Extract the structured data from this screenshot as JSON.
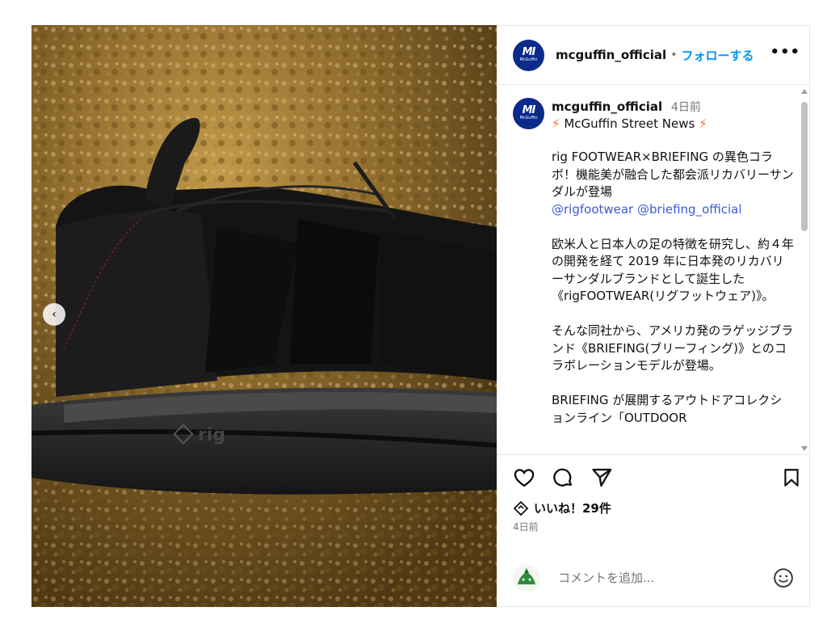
{
  "post": {
    "username": "mcguffin_official",
    "separator": "•",
    "follow_label": "フォローする",
    "more_label": "•••",
    "logo_mark": "MI",
    "logo_brand": "McGuffin"
  },
  "caption": {
    "username": "mcguffin_official",
    "time_ago": "4日前",
    "subtitle_icon": "⚡",
    "subtitle": "McGuffin Street News",
    "paragraph1": "rig FOOTWEAR×BRIEFING の異色コラボ！機能美が融合した都会派リカバリーサンダルが登場",
    "mention1": "@rigfootwear",
    "mention2": "@briefing_official",
    "paragraph2": "欧米人と日本人の足の特徴を研究し、約４年の開発を経て 2019 年に日本発のリカバリーサンダルブランドとして誕生した《rigFOOTWEAR(リグフットウェア)》。",
    "paragraph3": "そんな同社から、アメリカ発のラゲッジブランド《BRIEFING(ブリーフィング)》とのコラボレーションモデルが登場。",
    "paragraph4": "BRIEFING が展開するアウトドアコレクションライン「OUTDOOR"
  },
  "engagement": {
    "likes": "いいね！29件",
    "date": "4日前"
  },
  "comment": {
    "placeholder": "コメントを追加..."
  },
  "icons": {
    "prev": "chevron-left-icon",
    "like": "heart-icon",
    "comment": "comment-icon",
    "share": "share-icon",
    "save": "bookmark-icon",
    "emoji": "emoji-icon"
  },
  "colors": {
    "follow": "#0095f6",
    "mention": "#3b5bdb",
    "logo_bg": "#0b2a8c",
    "bolt": "#ff6a1f"
  }
}
